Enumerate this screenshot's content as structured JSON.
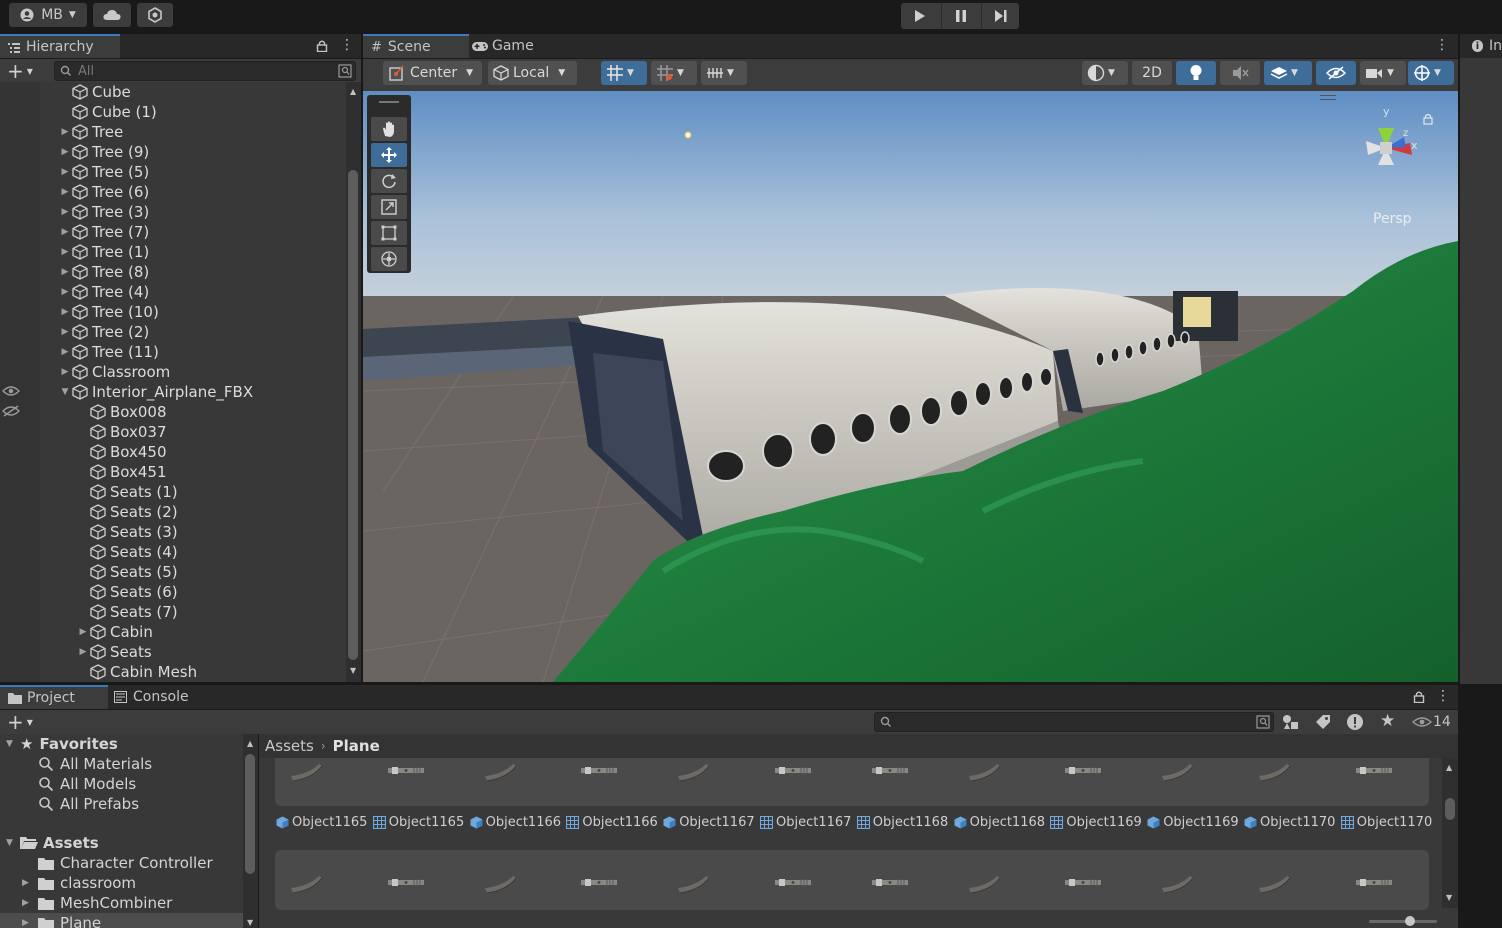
{
  "toolbar": {
    "account_label": "MB",
    "account_dropdown_icon": "chevron-down-icon",
    "cloud_icon": "cloud-icon",
    "collab_icon": "collab-icon",
    "play_icon": "play-icon",
    "pause_icon": "pause-icon",
    "step_icon": "step-icon"
  },
  "hierarchy": {
    "tab_label": "Hierarchy",
    "search_placeholder": "All",
    "items": [
      {
        "label": "Cube",
        "depth": 1,
        "expander": ""
      },
      {
        "label": "Cube (1)",
        "depth": 1,
        "expander": ""
      },
      {
        "label": "Tree",
        "depth": 1,
        "expander": "▶"
      },
      {
        "label": "Tree (9)",
        "depth": 1,
        "expander": "▶"
      },
      {
        "label": "Tree (5)",
        "depth": 1,
        "expander": "▶"
      },
      {
        "label": "Tree (6)",
        "depth": 1,
        "expander": "▶"
      },
      {
        "label": "Tree (3)",
        "depth": 1,
        "expander": "▶"
      },
      {
        "label": "Tree (7)",
        "depth": 1,
        "expander": "▶"
      },
      {
        "label": "Tree (1)",
        "depth": 1,
        "expander": "▶"
      },
      {
        "label": "Tree (8)",
        "depth": 1,
        "expander": "▶"
      },
      {
        "label": "Tree (4)",
        "depth": 1,
        "expander": "▶"
      },
      {
        "label": "Tree (10)",
        "depth": 1,
        "expander": "▶"
      },
      {
        "label": "Tree (2)",
        "depth": 1,
        "expander": "▶"
      },
      {
        "label": "Tree (11)",
        "depth": 1,
        "expander": "▶"
      },
      {
        "label": "Classroom",
        "depth": 1,
        "expander": "▶"
      },
      {
        "label": "Interior_Airplane_FBX",
        "depth": 1,
        "expander": "▼"
      },
      {
        "label": "Box008",
        "depth": 2,
        "expander": ""
      },
      {
        "label": "Box037",
        "depth": 2,
        "expander": ""
      },
      {
        "label": "Box450",
        "depth": 2,
        "expander": ""
      },
      {
        "label": "Box451",
        "depth": 2,
        "expander": ""
      },
      {
        "label": "Seats (1)",
        "depth": 2,
        "expander": ""
      },
      {
        "label": "Seats (2)",
        "depth": 2,
        "expander": ""
      },
      {
        "label": "Seats (3)",
        "depth": 2,
        "expander": ""
      },
      {
        "label": "Seats (4)",
        "depth": 2,
        "expander": ""
      },
      {
        "label": "Seats (5)",
        "depth": 2,
        "expander": ""
      },
      {
        "label": "Seats (6)",
        "depth": 2,
        "expander": ""
      },
      {
        "label": "Seats (7)",
        "depth": 2,
        "expander": ""
      },
      {
        "label": "Cabin",
        "depth": 2,
        "expander": "▶"
      },
      {
        "label": "Seats",
        "depth": 2,
        "expander": "▶"
      },
      {
        "label": "Cabin Mesh",
        "depth": 2,
        "expander": ""
      }
    ]
  },
  "scene": {
    "tab_scene": "Scene",
    "tab_game": "Game",
    "pivot_label": "Center",
    "space_label": "Local",
    "mode_2d": "2D",
    "persp_label": "Persp",
    "gizmo_y": "y",
    "gizmo_z": "z",
    "gizmo_x": "x",
    "tools": [
      "hand-tool-icon",
      "move-tool-icon",
      "rotate-tool-icon",
      "scale-tool-icon",
      "rect-tool-icon",
      "transform-tool-icon"
    ]
  },
  "inspector": {
    "tab_label": "In"
  },
  "project": {
    "tab_project": "Project",
    "tab_console": "Console",
    "hidden_count": "14",
    "breadcrumb": [
      "Assets",
      "Plane"
    ],
    "favorites_label": "Favorites",
    "favorites": [
      "All Materials",
      "All Models",
      "All Prefabs"
    ],
    "assets_label": "Assets",
    "folders": [
      {
        "label": "Character Controller",
        "expander": ""
      },
      {
        "label": "classroom",
        "expander": "▶"
      },
      {
        "label": "MeshCombiner",
        "expander": "▶"
      },
      {
        "label": "Plane",
        "expander": "▶"
      }
    ],
    "asset_items": [
      {
        "label": "Object1165",
        "kind": "mesh"
      },
      {
        "label": "Object1165",
        "kind": "grid"
      },
      {
        "label": "Object1166",
        "kind": "mesh"
      },
      {
        "label": "Object1166",
        "kind": "grid"
      },
      {
        "label": "Object1167",
        "kind": "mesh"
      },
      {
        "label": "Object1167",
        "kind": "grid"
      },
      {
        "label": "Object1168",
        "kind": "grid"
      },
      {
        "label": "Object1168",
        "kind": "mesh"
      },
      {
        "label": "Object1169",
        "kind": "grid"
      },
      {
        "label": "Object1169",
        "kind": "mesh"
      },
      {
        "label": "Object1170",
        "kind": "mesh"
      },
      {
        "label": "Object1170",
        "kind": "grid"
      }
    ]
  },
  "colors": {
    "accent_blue": "#3a79bb",
    "sky": "#b3c6d9",
    "ground": "#6a6360",
    "terrain": "#1f7a3a"
  }
}
